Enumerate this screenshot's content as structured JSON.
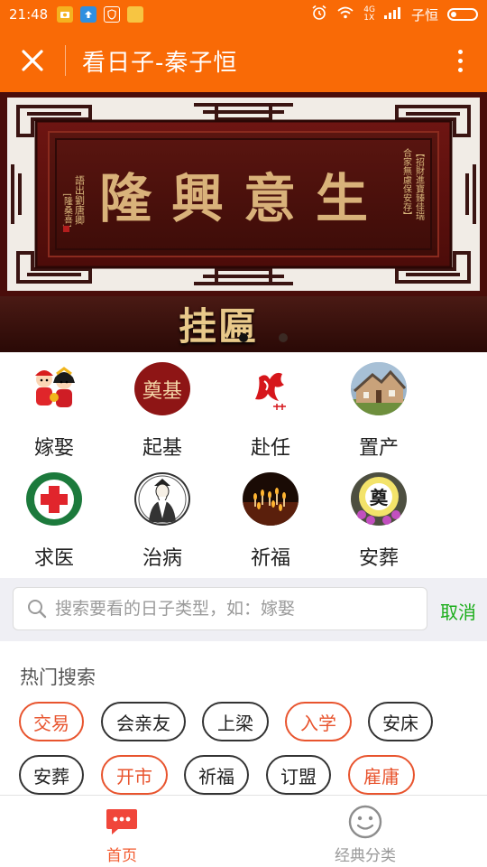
{
  "status_bar": {
    "time": "21:48",
    "network": "4G",
    "signal_sub": "1X",
    "carrier": "子恒"
  },
  "title_bar": {
    "title": "看日子-秦子恒"
  },
  "banner": {
    "plaque_text": "生意興隆",
    "left_inscription": "語出劉唐卿",
    "left_seal": "[隆桑喜]",
    "right_inscription": "【招財進寶臻佳瑞",
    "right_inscription_2": "合家無慮保安存】",
    "caption": "挂匾",
    "slide_count": 2,
    "active_slide": 0
  },
  "categories": [
    {
      "label": "嫁娶",
      "icon": "wedding-couple-icon"
    },
    {
      "label": "起基",
      "icon": "foundation-seal-icon",
      "icon_text": "奠基"
    },
    {
      "label": "赴任",
      "icon": "horse-calligraphy-icon"
    },
    {
      "label": "置产",
      "icon": "house-icon"
    },
    {
      "label": "求医",
      "icon": "medical-cross-icon"
    },
    {
      "label": "治病",
      "icon": "doctor-portrait-icon"
    },
    {
      "label": "祈福",
      "icon": "candles-icon"
    },
    {
      "label": "安葬",
      "icon": "funeral-wreath-icon",
      "icon_text": "奠"
    }
  ],
  "search": {
    "placeholder": "搜索要看的日子类型，如：嫁娶",
    "value": "",
    "cancel_label": "取消"
  },
  "hot_search": {
    "title": "热门搜索",
    "tags": [
      {
        "label": "交易",
        "highlighted": true
      },
      {
        "label": "会亲友",
        "highlighted": false
      },
      {
        "label": "上梁",
        "highlighted": false
      },
      {
        "label": "入学",
        "highlighted": true
      },
      {
        "label": "安床",
        "highlighted": false
      },
      {
        "label": "安葬",
        "highlighted": false
      },
      {
        "label": "开市",
        "highlighted": true
      },
      {
        "label": "祈福",
        "highlighted": false
      },
      {
        "label": "订盟",
        "highlighted": false
      },
      {
        "label": "雇庸",
        "highlighted": true
      }
    ]
  },
  "tab_bar": {
    "tabs": [
      {
        "label": "首页",
        "icon": "home-message-icon",
        "active": true
      },
      {
        "label": "经典分类",
        "icon": "smiley-icon",
        "active": false
      }
    ]
  },
  "colors": {
    "brand_orange": "#f96a06",
    "highlight_tag": "#e8542e",
    "cancel_green": "#1aad19",
    "tab_active": "#f25a2e",
    "tab_inactive": "#999999"
  }
}
